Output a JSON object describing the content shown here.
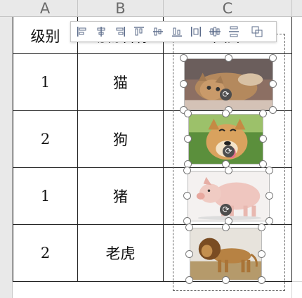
{
  "columns": [
    "A",
    "B",
    "C"
  ],
  "header_row": {
    "level_label": "级别",
    "name_label": "动物名称",
    "image_label": "图片"
  },
  "rows": [
    {
      "level": "1",
      "name": "猫",
      "image": "cat"
    },
    {
      "level": "2",
      "name": "狗",
      "image": "dog"
    },
    {
      "level": "1",
      "name": "猪",
      "image": "pig"
    },
    {
      "level": "2",
      "name": "老虎",
      "image": "lion"
    }
  ],
  "toolbar": {
    "icons": [
      "align-left-icon",
      "align-center-icon",
      "align-right-icon",
      "align-top-icon",
      "align-middle-icon",
      "align-bottom-icon",
      "distribute-horizontally-icon",
      "distribute-vertically-icon",
      "distribute-spacing-icon",
      "group-objects-icon"
    ]
  },
  "colors": {
    "header_bg": "#e9e9e9",
    "grid_border": "#222222",
    "gridline": "#d6d6d6",
    "toolbar_icon": "#5b6b8a"
  }
}
